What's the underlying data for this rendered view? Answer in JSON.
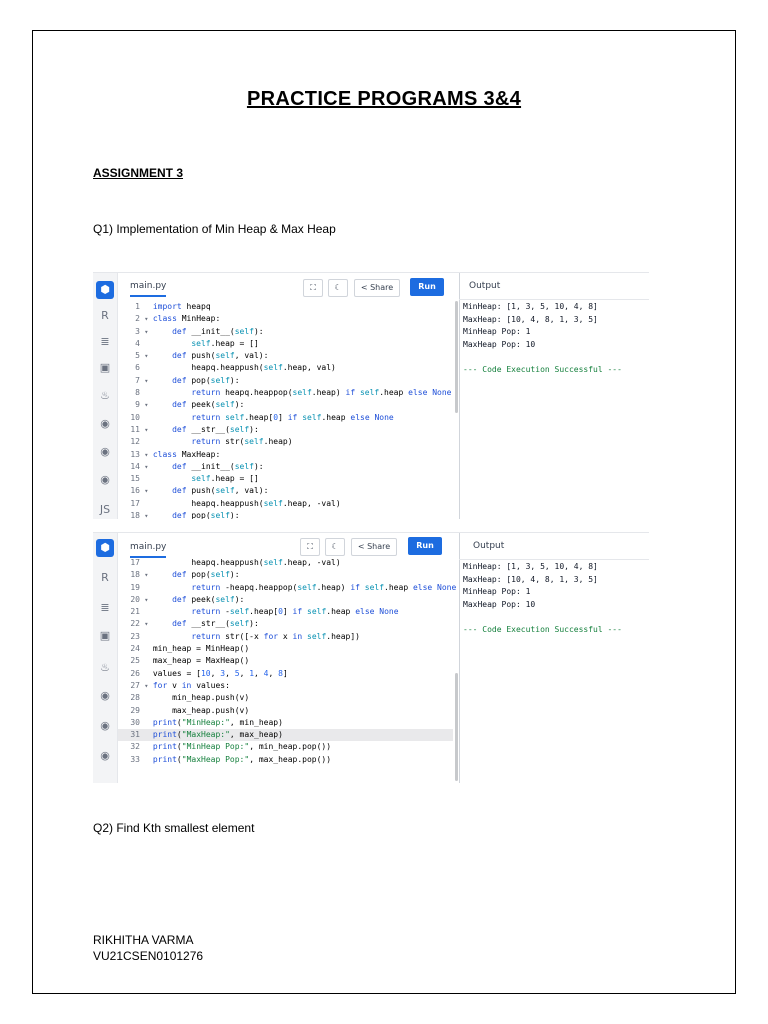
{
  "document": {
    "title": "PRACTICE PROGRAMS 3&4",
    "section": "ASSIGNMENT 3",
    "q1": "Q1) Implementation of Min Heap & Max  Heap",
    "q2": "Q2) Find Kth smallest element",
    "author_name": "RIKHITHA VARMA",
    "author_id": "VU21CSEN0101276"
  },
  "editor": {
    "file_name": "main.py",
    "share_label": "Share",
    "run_label": "Run",
    "output_label": "Output",
    "rail_icons": [
      "python-icon",
      "r-icon",
      "database-icon",
      "html-icon",
      "java-icon",
      "c-icon",
      "cpp-icon",
      "csharp-icon",
      "js-icon"
    ],
    "accent_color": "#1d6ce0"
  },
  "screenshot1": {
    "code_lines": [
      {
        "n": "1",
        "fold": "",
        "text": "import heapq"
      },
      {
        "n": "2",
        "fold": "▾",
        "text": "class MinHeap:"
      },
      {
        "n": "3",
        "fold": "▾",
        "text": "    def __init__(self):"
      },
      {
        "n": "4",
        "fold": "",
        "text": "        self.heap = []"
      },
      {
        "n": "5",
        "fold": "▾",
        "text": "    def push(self, val):"
      },
      {
        "n": "6",
        "fold": "",
        "text": "        heapq.heappush(self.heap, val)"
      },
      {
        "n": "7",
        "fold": "▾",
        "text": "    def pop(self):"
      },
      {
        "n": "8",
        "fold": "",
        "text": "        return heapq.heappop(self.heap) if self.heap else None"
      },
      {
        "n": "9",
        "fold": "▾",
        "text": "    def peek(self):"
      },
      {
        "n": "10",
        "fold": "",
        "text": "        return self.heap[0] if self.heap else None"
      },
      {
        "n": "11",
        "fold": "▾",
        "text": "    def __str__(self):"
      },
      {
        "n": "12",
        "fold": "",
        "text": "        return str(self.heap)"
      },
      {
        "n": "13",
        "fold": "▾",
        "text": "class MaxHeap:"
      },
      {
        "n": "14",
        "fold": "▾",
        "text": "    def __init__(self):"
      },
      {
        "n": "15",
        "fold": "",
        "text": "        self.heap = []"
      },
      {
        "n": "16",
        "fold": "▾",
        "text": "    def push(self, val):"
      },
      {
        "n": "17",
        "fold": "",
        "text": "        heapq.heappush(self.heap, -val)"
      },
      {
        "n": "18",
        "fold": "▾",
        "text": "    def pop(self):"
      }
    ],
    "output_lines": [
      "MinHeap: [1, 3, 5, 10, 4, 8]",
      "MaxHeap: [10, 4, 8, 1, 3, 5]",
      "MinHeap Pop: 1",
      "MaxHeap Pop: 10",
      "",
      "--- Code Execution Successful ---"
    ]
  },
  "screenshot2": {
    "code_lines": [
      {
        "n": "17",
        "fold": "",
        "text": "        heapq.heappush(self.heap, -val)"
      },
      {
        "n": "18",
        "fold": "▾",
        "text": "    def pop(self):"
      },
      {
        "n": "19",
        "fold": "",
        "text": "        return -heapq.heappop(self.heap) if self.heap else None"
      },
      {
        "n": "20",
        "fold": "▾",
        "text": "    def peek(self):"
      },
      {
        "n": "21",
        "fold": "",
        "text": "        return -self.heap[0] if self.heap else None"
      },
      {
        "n": "22",
        "fold": "▾",
        "text": "    def __str__(self):"
      },
      {
        "n": "23",
        "fold": "",
        "text": "        return str([-x for x in self.heap])"
      },
      {
        "n": "24",
        "fold": "",
        "text": "min_heap = MinHeap()"
      },
      {
        "n": "25",
        "fold": "",
        "text": "max_heap = MaxHeap()"
      },
      {
        "n": "26",
        "fold": "",
        "text": "values = [10, 3, 5, 1, 4, 8]"
      },
      {
        "n": "27",
        "fold": "▾",
        "text": "for v in values:"
      },
      {
        "n": "28",
        "fold": "",
        "text": "    min_heap.push(v)"
      },
      {
        "n": "29",
        "fold": "",
        "text": "    max_heap.push(v)"
      },
      {
        "n": "30",
        "fold": "",
        "text": "print(\"MinHeap:\", min_heap)"
      },
      {
        "n": "31",
        "fold": "",
        "text": "print(\"MaxHeap:\", max_heap)"
      },
      {
        "n": "32",
        "fold": "",
        "text": "print(\"MinHeap Pop:\", min_heap.pop())"
      },
      {
        "n": "33",
        "fold": "",
        "text": "print(\"MaxHeap Pop:\", max_heap.pop())"
      }
    ],
    "output_lines": [
      "MinHeap: [1, 3, 5, 10, 4, 8]",
      "MaxHeap: [10, 4, 8, 1, 3, 5]",
      "MinHeap Pop: 1",
      "MaxHeap Pop: 10",
      "",
      "--- Code Execution Successful ---"
    ]
  }
}
